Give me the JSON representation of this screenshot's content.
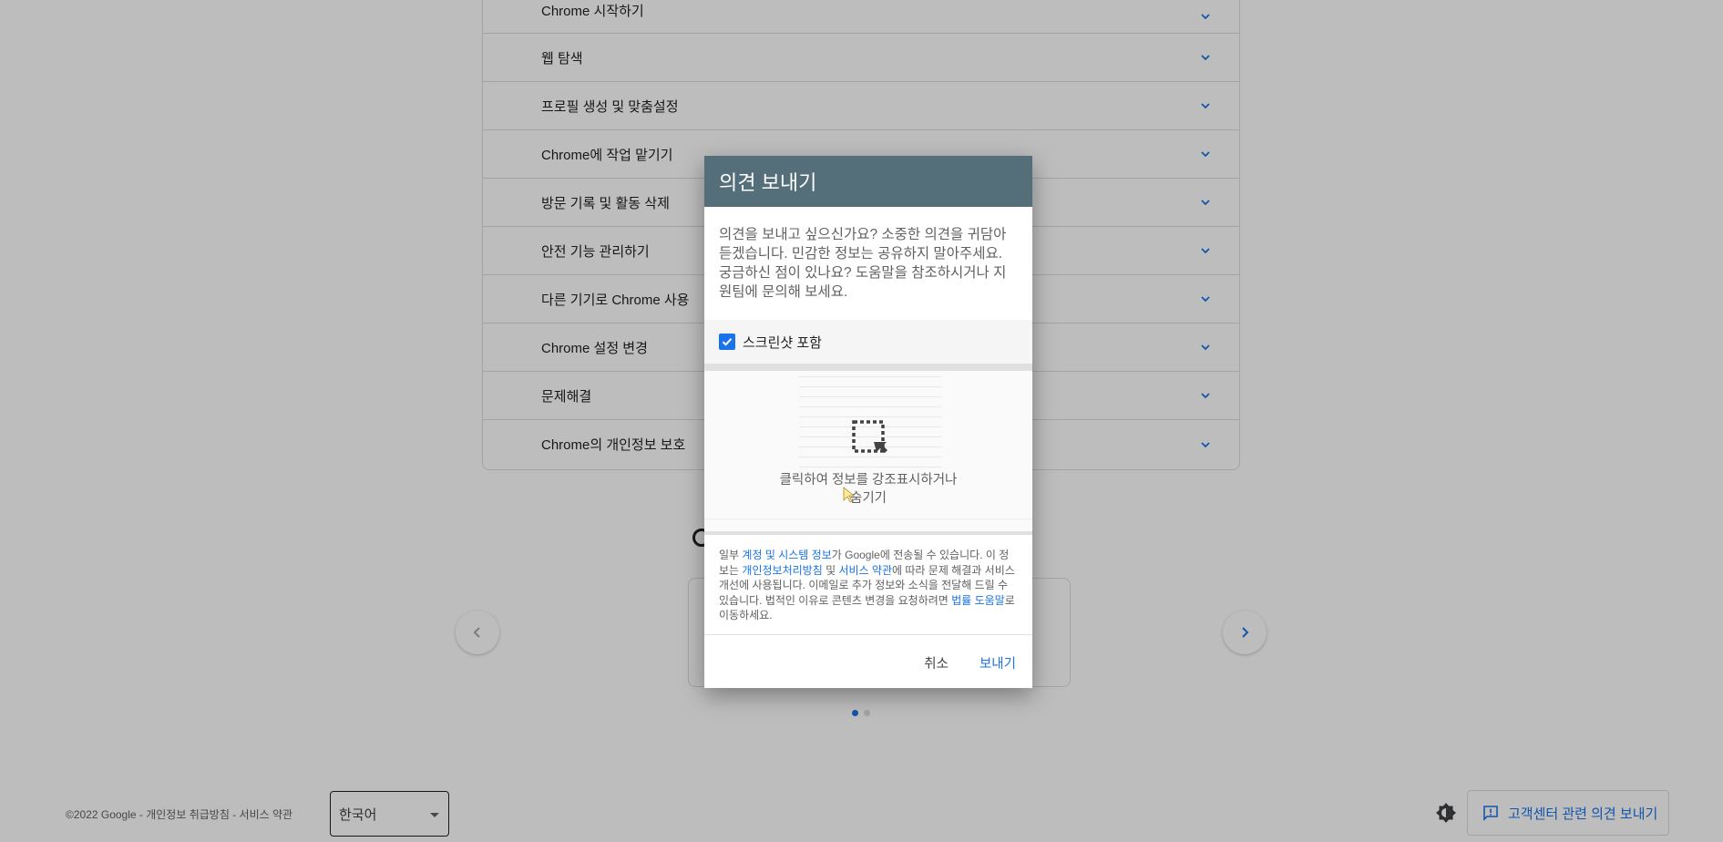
{
  "accordion": {
    "items": [
      {
        "label": "Chrome 시작하기"
      },
      {
        "label": "웹 탐색"
      },
      {
        "label": "프로필 생성 및 맞춤설정"
      },
      {
        "label": "Chrome에 작업 맡기기"
      },
      {
        "label": "방문 기록 및 활동 삭제"
      },
      {
        "label": "안전 기능 관리하기"
      },
      {
        "label": "다른 기기로 Chrome 사용"
      },
      {
        "label": "Chrome 설정 변경"
      },
      {
        "label": "문제해결"
      },
      {
        "label": "Chrome의 개인정보 보호"
      }
    ]
  },
  "footer": {
    "copyright": "©2022 Google - 개인정보 취급방침 - 서비스 약관",
    "language": "한국어",
    "help_feedback_label": "고객센터 관련 의견 보내기"
  },
  "dialog": {
    "title": "의견 보내기",
    "intro": "의견을 보내고 싶으신가요? 소중한 의견을 귀담아 듣겠습니다. 민감한 정보는 공유하지 말아주세요. 궁금하신 점이 있나요? 도움말을 참조하시거나 지원팀에 문의해 보세요.",
    "include_screenshot_label": "스크린샷 포함",
    "include_screenshot_checked": true,
    "preview_caption": "클릭하여 정보를 강조표시하거나 숨기기",
    "legal": {
      "part1": "일부 ",
      "link_account": "계정 및 시스템 정보",
      "part2": "가 Google에 전송될 수 있습니다. 이 정보는 ",
      "link_privacy": "개인정보처리방침",
      "part3": " 및 ",
      "link_terms": "서비스 약관",
      "part4": "에 따라 문제 해결과 서비스 개선에 사용됩니다. 이메일로 추가 정보와 소식을 전달해 드릴 수 있습니다. 법적인 이유로 콘텐츠 변경을 요청하려면 ",
      "link_legal_help": "법률 도움말",
      "part5": "로 이동하세요."
    },
    "cancel_label": "취소",
    "send_label": "보내기"
  },
  "colors": {
    "dialog_header": "#546e7a",
    "accent": "#1a73e8",
    "scrim": "rgba(0,0,0,0.26)"
  },
  "carousel": {
    "page_count": 2,
    "active_page": 1
  }
}
